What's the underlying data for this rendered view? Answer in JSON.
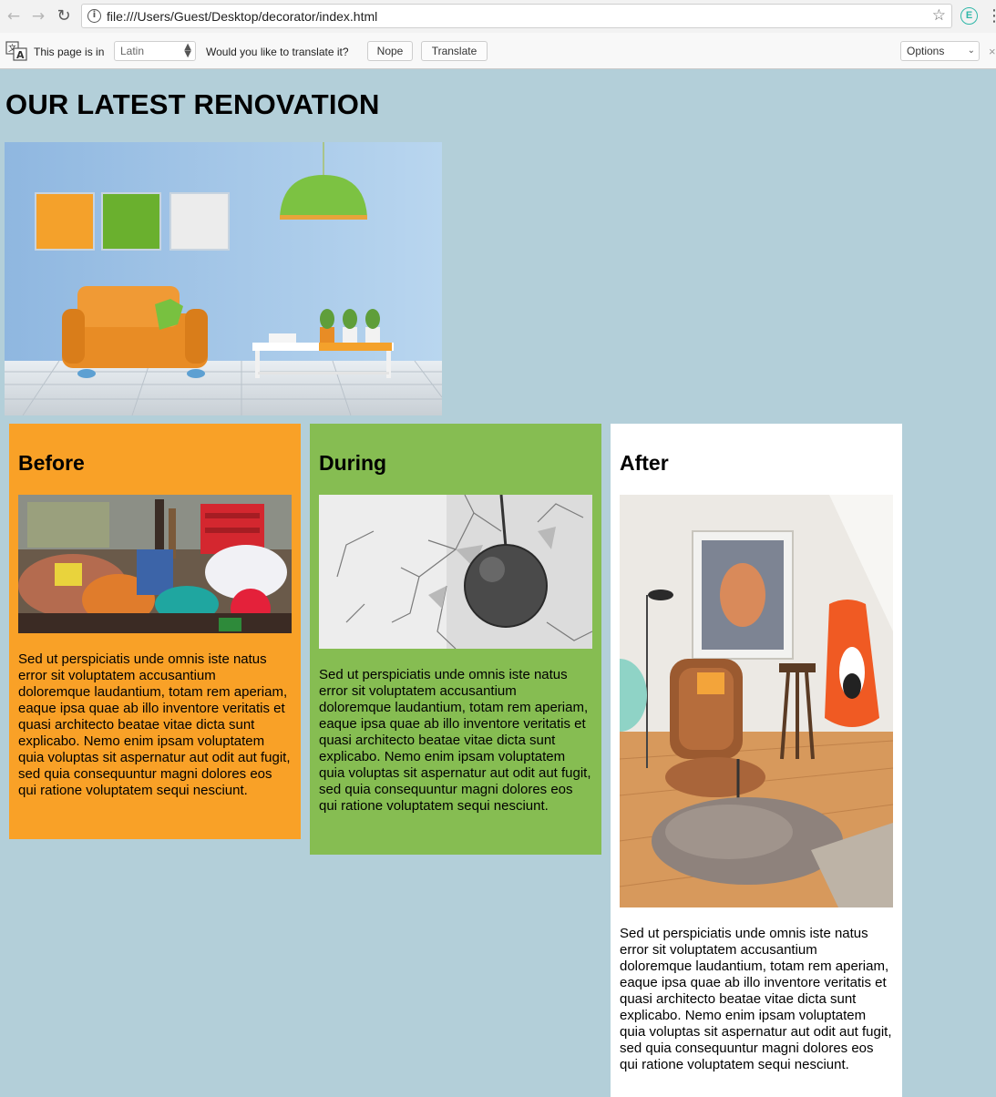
{
  "browser": {
    "url": "file:///Users/Guest/Desktop/decorator/index.html",
    "extension_letter": "E",
    "translate_bar": {
      "prefix": "This page is in",
      "language": "Latin",
      "question": "Would you like to translate it?",
      "nope_label": "Nope",
      "translate_label": "Translate",
      "options_label": "Options"
    }
  },
  "page": {
    "title": "OUR LATEST RENOVATION",
    "stages": [
      {
        "heading": "Before",
        "color": "#f9a127",
        "text": "Sed ut perspiciatis unde omnis iste natus error sit voluptatem accusantium doloremque laudantium, totam rem aperiam, eaque ipsa quae ab illo inventore veritatis et quasi architecto beatae vitae dicta sunt explicabo. Nemo enim ipsam voluptatem quia voluptas sit aspernatur aut odit aut fugit, sed quia consequuntur magni dolores eos qui ratione voluptatem sequi nesciunt."
      },
      {
        "heading": "During",
        "color": "#86bd52",
        "text": "Sed ut perspiciatis unde omnis iste natus error sit voluptatem accusantium doloremque laudantium, totam rem aperiam, eaque ipsa quae ab illo inventore veritatis et quasi architecto beatae vitae dicta sunt explicabo. Nemo enim ipsam voluptatem quia voluptas sit aspernatur aut odit aut fugit, sed quia consequuntur magni dolores eos qui ratione voluptatem sequi nesciunt."
      },
      {
        "heading": "After",
        "color": "#ffffff",
        "text": "Sed ut perspiciatis unde omnis iste natus error sit voluptatem accusantium doloremque laudantium, totam rem aperiam, eaque ipsa quae ab illo inventore veritatis et quasi architecto beatae vitae dicta sunt explicabo. Nemo enim ipsam voluptatem quia voluptas sit aspernatur aut odit aut fugit, sed quia consequuntur magni dolores eos qui ratione voluptatem sequi nesciunt."
      }
    ]
  },
  "icons": {
    "back": "back-arrow-icon",
    "forward": "forward-arrow-icon",
    "reload": "reload-icon",
    "info": "info-icon",
    "star": "star-icon",
    "menu": "kebab-menu-icon",
    "translate": "translate-icon",
    "close": "close-icon"
  }
}
